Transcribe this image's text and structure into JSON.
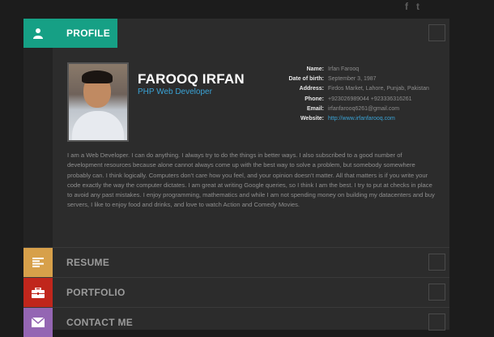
{
  "social": [
    "f",
    "t"
  ],
  "profile": {
    "tab_label": "PROFILE",
    "name": "FAROOQ IRFAN",
    "role": "PHP Web Developer",
    "info": [
      {
        "key": "Name:",
        "value": "Irfan Farooq"
      },
      {
        "key": "Date of birth:",
        "value": "September 3, 1987"
      },
      {
        "key": "Address:",
        "value": "Firdos Market, Lahore, Punjab, Pakistan"
      },
      {
        "key": "Phone:",
        "value": "+923026989044 +923336316261"
      },
      {
        "key": "Email:",
        "value": "irfanfarooq6261@gmail.com"
      },
      {
        "key": "Website:",
        "value": "http://www.irfanfarooq.com"
      }
    ],
    "bio": "I am a Web Developer. I can do anything. I always try to do the things in better ways. I also subscribed to a good number of development resources because alone cannot always come up with the best way to solve a problem, but somebody somewhere probably can. I think logically. Computers don't care how you feel, and your opinion doesn't matter. All that matters is if you write your code exactly the way the computer dictates. I am great at writing Google queries, so I think I am the best. I try to put at checks in place to avoid any past mistakes. I enjoy programming, mathematics and while I am not spending money on building my datacenters and buy servers, I like to enjoy food and drinks, and love to watch Action and Comedy Movies."
  },
  "tabs": {
    "resume": "RESUME",
    "portfolio": "PORTFOLIO",
    "contact": "CONTACT ME"
  },
  "colors": {
    "profile": "#16a085",
    "resume": "#d7a04a",
    "portfolio": "#c0261c",
    "contact": "#9466b3",
    "link": "#3aa3d6"
  },
  "icons": {
    "profile": "user-icon",
    "resume": "list-icon",
    "portfolio": "briefcase-icon",
    "contact": "envelope-icon"
  }
}
